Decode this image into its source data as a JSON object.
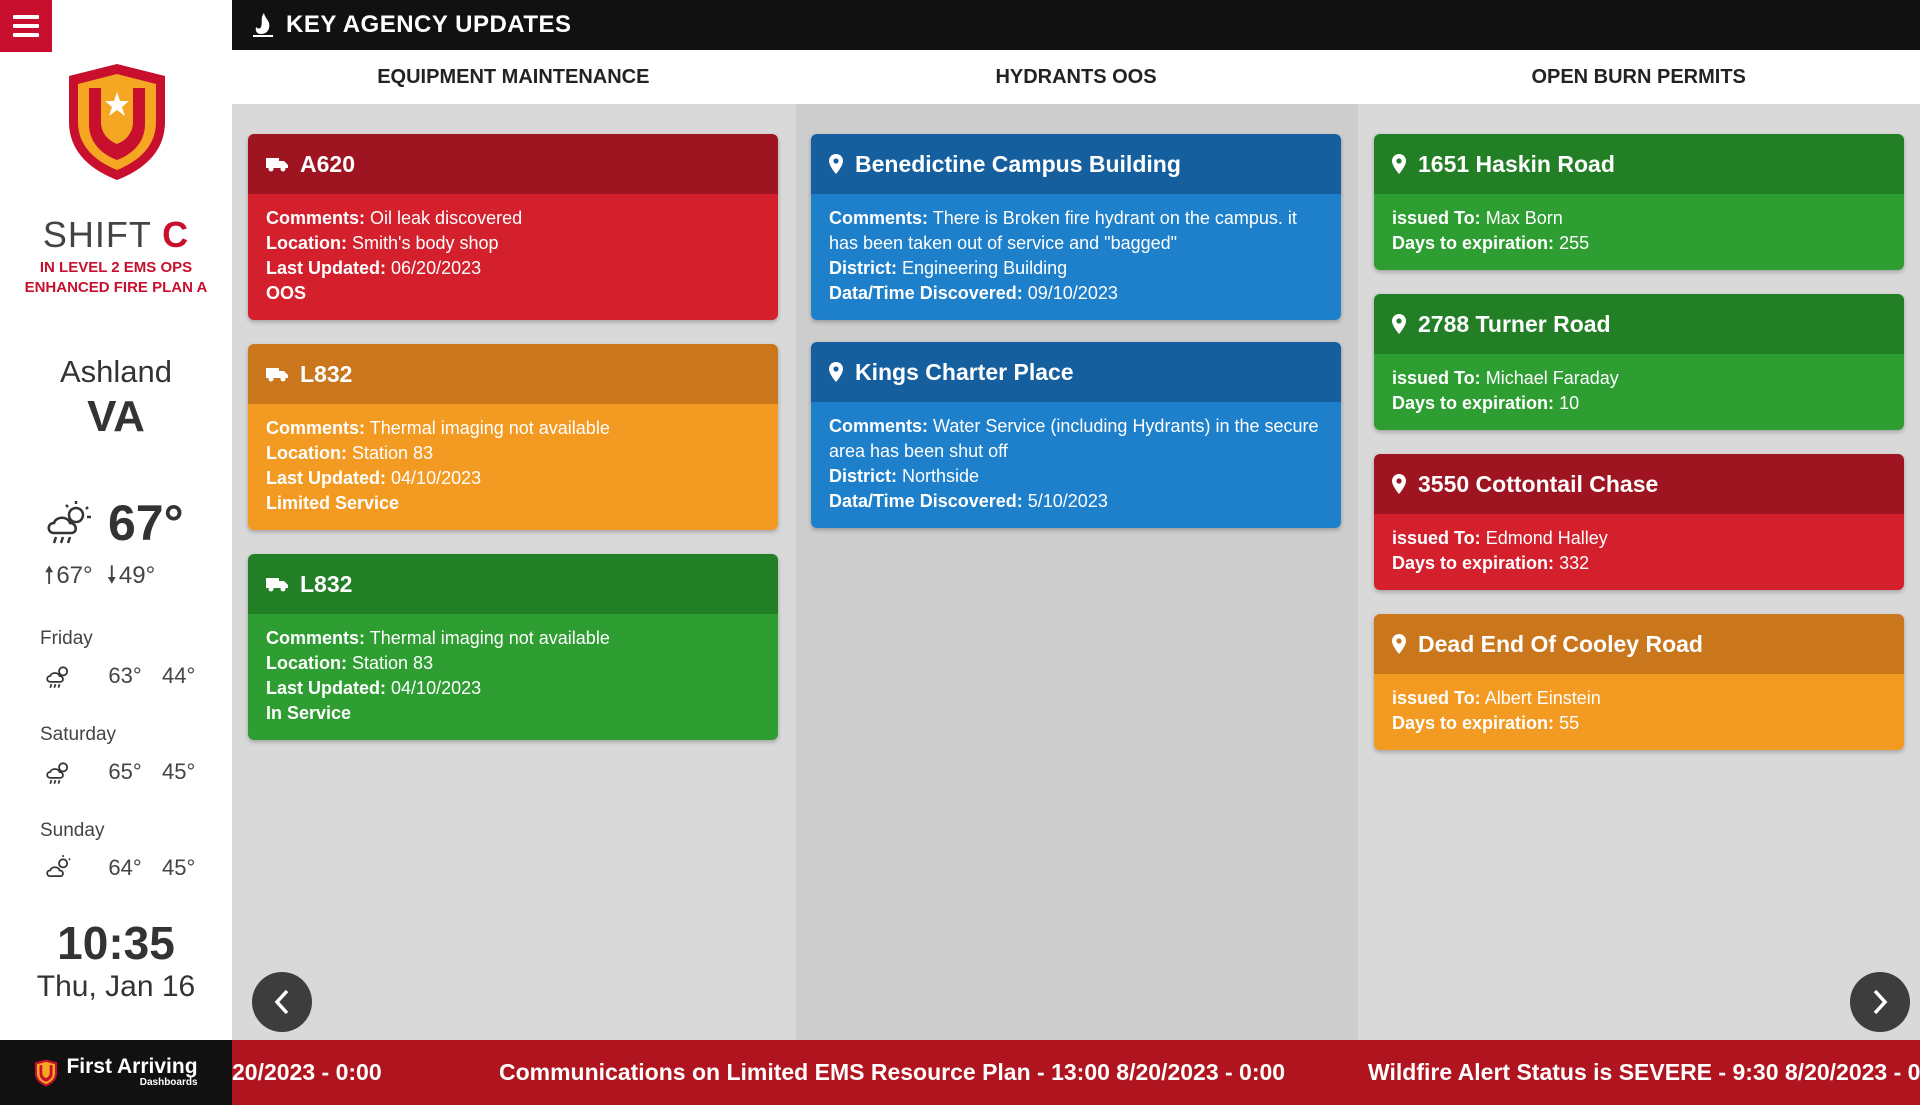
{
  "sidebar": {
    "shift_label": "SHIFT",
    "shift_letter": "C",
    "status_lines": [
      "IN LEVEL 2 EMS OPS",
      "ENHANCED FIRE PLAN A"
    ],
    "city": "Ashland",
    "state": "VA",
    "current_temp": "67°",
    "high": "67°",
    "low": "49°",
    "forecast": [
      {
        "day": "Friday",
        "hi": "63°",
        "lo": "44°",
        "icon": "rain-sun-icon"
      },
      {
        "day": "Saturday",
        "hi": "65°",
        "lo": "45°",
        "icon": "rain-sun-icon"
      },
      {
        "day": "Sunday",
        "hi": "64°",
        "lo": "45°",
        "icon": "partly-cloudy-icon"
      }
    ],
    "time": "10:35",
    "date": "Thu, Jan 16"
  },
  "header": {
    "title": "KEY AGENCY UPDATES"
  },
  "columns": {
    "col1": "EQUIPMENT MAINTENANCE",
    "col2": "HYDRANTS OOS",
    "col3": "OPEN BURN PERMITS"
  },
  "equipment": [
    {
      "title": "A620",
      "comments": "Oil leak discovered",
      "location": "Smith's body shop",
      "updated": "06/20/2023",
      "status": "OOS",
      "color": "red"
    },
    {
      "title": "L832",
      "comments": "Thermal imaging not available",
      "location": "Station 83",
      "updated": "04/10/2023",
      "status": "Limited Service",
      "color": "orange"
    },
    {
      "title": "L832",
      "comments": "Thermal imaging not available",
      "location": "Station 83",
      "updated": "04/10/2023",
      "status": "In Service",
      "color": "green"
    }
  ],
  "hydrants": [
    {
      "title": "Benedictine Campus Building",
      "comments": "There is Broken fire hydrant on the campus. it has been taken out of service and \"bagged\"",
      "district": "Engineering Building",
      "discovered": "09/10/2023"
    },
    {
      "title": "Kings Charter Place",
      "comments": "Water Service (including Hydrants) in the secure area has been shut off",
      "district": "Northside",
      "discovered": "5/10/2023"
    }
  ],
  "permits": [
    {
      "title": "1651 Haskin Road",
      "issued_to": "Max Born",
      "days": "255",
      "color": "green"
    },
    {
      "title": "2788 Turner Road",
      "issued_to": "Michael Faraday",
      "days": "10",
      "color": "green"
    },
    {
      "title": "3550 Cottontail Chase",
      "issued_to": "Edmond Halley",
      "days": "332",
      "color": "red"
    },
    {
      "title": "Dead End Of Cooley Road",
      "issued_to": "Albert Einstein",
      "days": "55",
      "color": "orange"
    }
  ],
  "labels": {
    "comments": "Comments:",
    "location": "Location:",
    "last_updated": "Last Updated:",
    "district": "District:",
    "discovered": "Data/Time Discovered:",
    "issued_to": "issued To:",
    "days_to_exp": "Days to expiration:"
  },
  "ticker": {
    "items": [
      "20/2023 - 0:00",
      "Communications on Limited EMS Resource Plan - 13:00 8/20/2023 - 0:00",
      "Wildfire Alert Status is SEVERE - 9:30 8/20/2023 - 0:0"
    ],
    "brand": "First Arriving",
    "brand_sub": "Dashboards"
  },
  "colors": {
    "red": "#d41f2d",
    "orange": "#f39a22",
    "green": "#2e9d32",
    "blue": "#1e7fcb",
    "brand": "#c8102e"
  }
}
